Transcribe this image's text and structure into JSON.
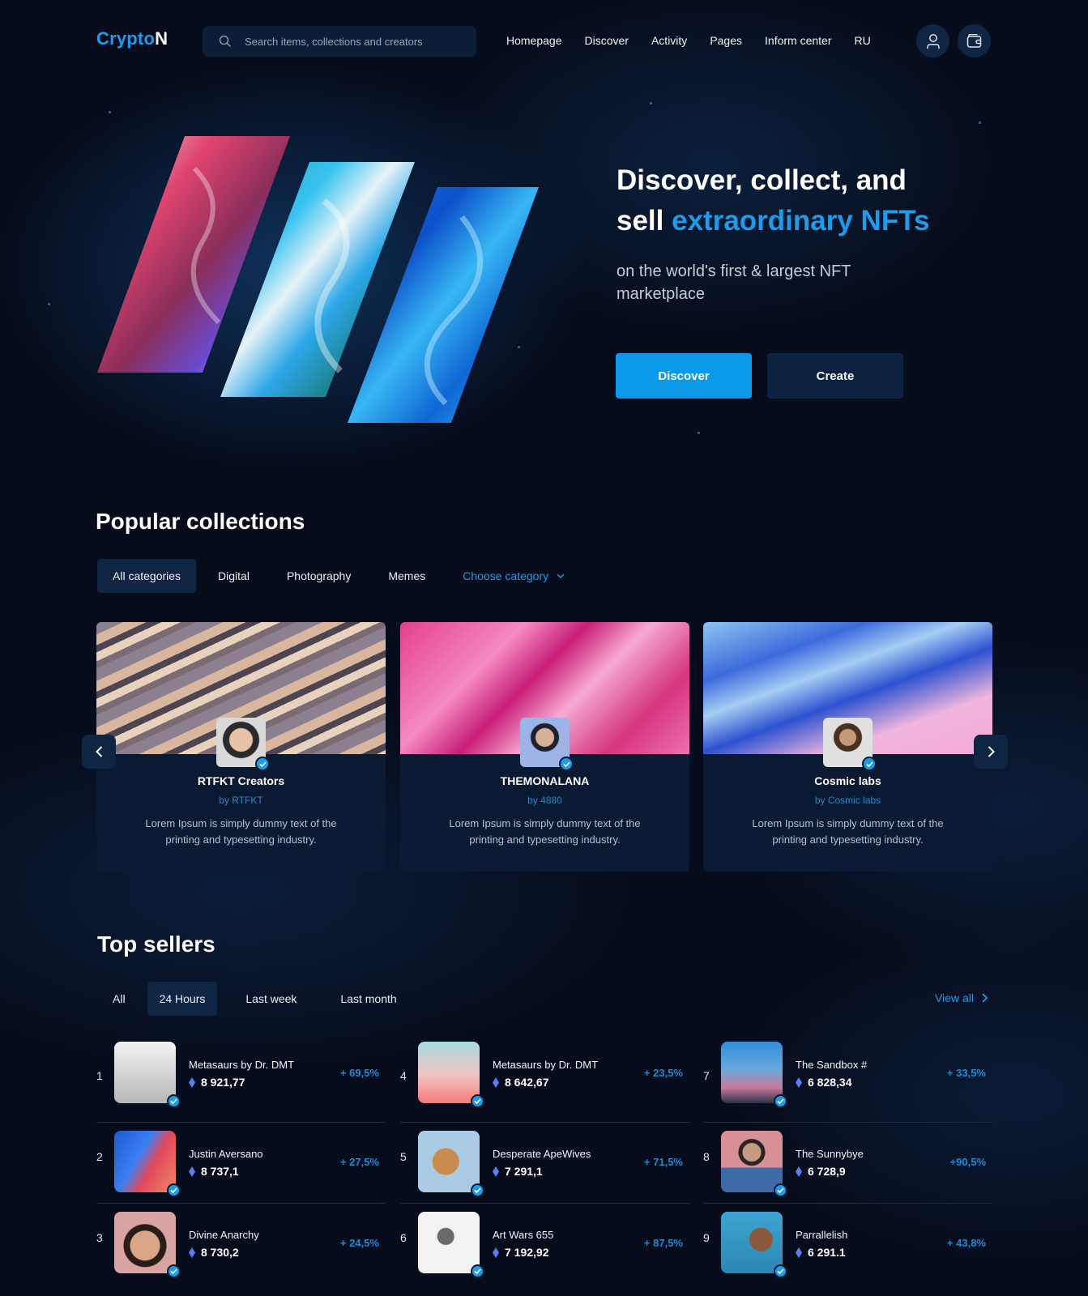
{
  "header": {
    "logo_part1": "Crypto",
    "logo_part2": "N",
    "search_placeholder": "Search items, collections and creators",
    "nav": [
      "Homepage",
      "Discover",
      "Activity",
      "Pages",
      "Inform center",
      "RU"
    ],
    "icons": [
      "user-icon",
      "wallet-icon"
    ]
  },
  "hero": {
    "title_line1": "Discover, collect, and",
    "title_line2_prefix": "sell ",
    "title_line2_accent": "extraordinary NFTs",
    "subtitle": "on the world's first & largest NFT marketplace",
    "primary_button": "Discover",
    "secondary_button": "Create"
  },
  "popular": {
    "title": "Popular collections",
    "tabs": [
      "All categories",
      "Digital",
      "Photography",
      "Memes"
    ],
    "active_tab": "All categories",
    "choose_category": "Choose category",
    "cards": [
      {
        "name": "RTFKT Creators",
        "by": "by RTFKT",
        "description": "Lorem Ipsum is simply dummy text of the printing and typesetting industry."
      },
      {
        "name": "THEMONALANA",
        "by": "by 4880",
        "description": "Lorem Ipsum is simply dummy text of the printing and typesetting industry."
      },
      {
        "name": "Cosmic labs",
        "by": "by Cosmic labs",
        "description": "Lorem Ipsum is simply dummy text of the printing and typesetting industry."
      }
    ]
  },
  "sellers": {
    "title": "Top sellers",
    "tabs": [
      "All",
      "24 Hours",
      "Last week",
      "Last month"
    ],
    "active_tab": "24 Hours",
    "view_all": "View all",
    "list": [
      {
        "rank": "1",
        "name": "Metasaurs by Dr. DMT",
        "price": "8 921,77",
        "change": "+ 69,5%"
      },
      {
        "rank": "2",
        "name": "Justin Aversano",
        "price": "8 737,1",
        "change": "+ 27,5%"
      },
      {
        "rank": "3",
        "name": "Divine Anarchy",
        "price": "8 730,2",
        "change": "+ 24,5%"
      },
      {
        "rank": "4",
        "name": "Metasaurs by Dr. DMT",
        "price": "8 642,67",
        "change": "+ 23,5%"
      },
      {
        "rank": "5",
        "name": "Desperate ApeWives",
        "price": "7 291,1",
        "change": "+ 71,5%"
      },
      {
        "rank": "6",
        "name": "Art Wars 655",
        "price": "7 192,92",
        "change": "+ 87,5%"
      },
      {
        "rank": "7",
        "name": "The Sandbox #",
        "price": "6 828,34",
        "change": "+ 33,5%"
      },
      {
        "rank": "8",
        "name": "The Sunnybye",
        "price": "6 728,9",
        "change": "+90,5%"
      },
      {
        "rank": "9",
        "name": "Parrallelish",
        "price": "6 291.1",
        "change": "+ 43,8%"
      }
    ]
  },
  "colors": {
    "accent": "#1f9bea",
    "background": "#060c1c",
    "surface": "#0b1a33",
    "button_dark": "#0d2140"
  }
}
